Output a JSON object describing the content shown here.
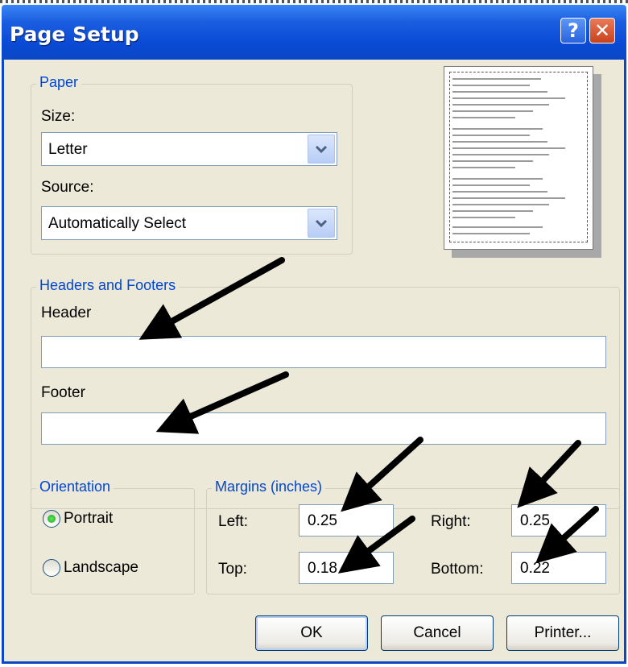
{
  "dialog": {
    "title": "Page Setup",
    "help_glyph": "?",
    "close_glyph": "✕"
  },
  "paper": {
    "legend": "Paper",
    "size_label": "Size:",
    "size_value": "Letter",
    "source_label": "Source:",
    "source_value": "Automatically Select"
  },
  "headers_footers": {
    "legend": "Headers and Footers",
    "header_label": "Header",
    "header_value": "",
    "footer_label": "Footer",
    "footer_value": ""
  },
  "orientation": {
    "legend": "Orientation",
    "portrait_label": "Portrait",
    "landscape_label": "Landscape",
    "selected": "Portrait"
  },
  "margins": {
    "legend": "Margins (inches)",
    "left_label": "Left:",
    "left_value": "0.25",
    "right_label": "Right:",
    "right_value": "0.25",
    "top_label": "Top:",
    "top_value": "0.18",
    "bottom_label": "Bottom:",
    "bottom_value": "0.22"
  },
  "buttons": {
    "ok": "OK",
    "cancel": "Cancel",
    "printer": "Printer..."
  },
  "icons": {
    "dropdown": "chevron-down-icon",
    "annotation": "arrow-icon"
  },
  "colors": {
    "titlebar": "#0b46c4",
    "dialog_bg": "#ece9d8",
    "legend_text": "#0046d5",
    "close_button": "#c9421c"
  }
}
